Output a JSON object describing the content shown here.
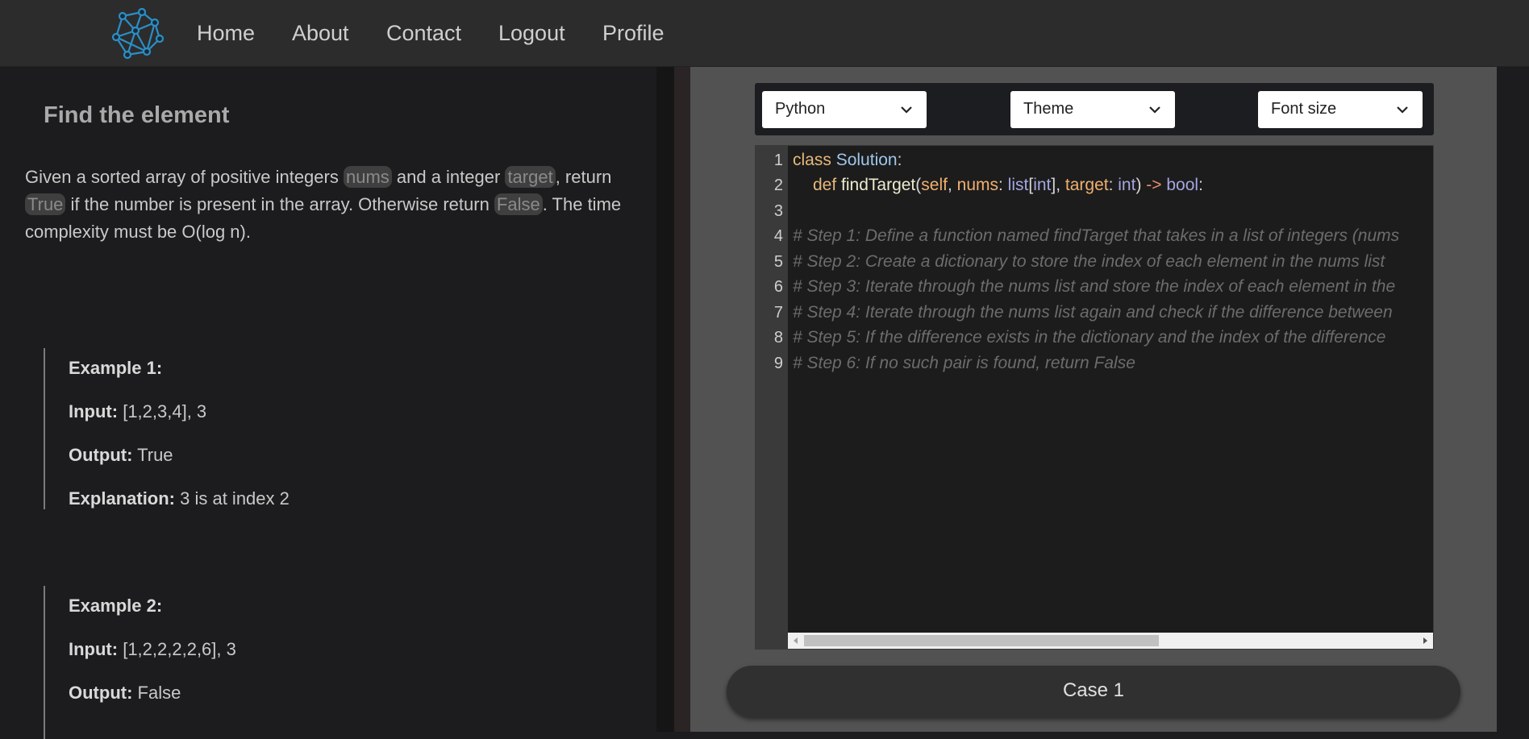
{
  "nav": {
    "items": [
      "Home",
      "About",
      "Contact",
      "Logout",
      "Profile"
    ]
  },
  "problem": {
    "title": "Find the element",
    "desc": {
      "p1": "Given a sorted array of positive integers ",
      "chip1": "nums",
      "p2": " and a integer ",
      "chip2": "target",
      "p3": ", return ",
      "chip3": "True",
      "p4": " if the number is present in the array. Otherwise return ",
      "chip4": "False",
      "p5": ". The time complexity must be O(log n)."
    },
    "examples": [
      {
        "heading": "Example 1:",
        "input_label": "Input:",
        "input": " [1,2,3,4], 3",
        "output_label": "Output:",
        "output": " True",
        "explanation_label": "Explanation:",
        "explanation": " 3 is at index 2"
      },
      {
        "heading": "Example 2:",
        "input_label": "Input:",
        "input": " [1,2,2,2,2,6], 3",
        "output_label": "Output:",
        "output": " False"
      }
    ]
  },
  "editor": {
    "language": "Python",
    "theme": "Theme",
    "font_size": "Font size",
    "line_numbers": [
      "1",
      "2",
      "3",
      "4",
      "5",
      "6",
      "7",
      "8",
      "9"
    ],
    "code": {
      "l1_kw": "class",
      "l1_cls": "Solution",
      "l1_colon": ":",
      "l2_kw": "def",
      "l2_fn": "findTarget",
      "l2_open": "(",
      "l2_self": "self",
      "l2_comma1": ", ",
      "l2_nums": "nums",
      "l2_colon1": ": ",
      "l2_list": "list",
      "l2_lb": "[",
      "l2_int1": "int",
      "l2_rb": "]",
      "l2_comma2": ", ",
      "l2_target": "target",
      "l2_colon2": ": ",
      "l2_int2": "int",
      "l2_close": ") ",
      "l2_arrow": "->",
      "l2_bool": " bool",
      "l2_colon3": ":",
      "comments": [
        "# Step 1: Define a function named findTarget that takes in a list of integers (nums",
        "# Step 2: Create a dictionary to store the index of each element in the nums list",
        "# Step 3: Iterate through the nums list and store the index of each element in the",
        "# Step 4: Iterate through the nums list again and check if the difference between",
        "# Step 5: If the difference exists in the dictionary and the index of the difference",
        "# Step 6: If no such pair is found, return False"
      ]
    }
  },
  "case_button": "Case 1"
}
